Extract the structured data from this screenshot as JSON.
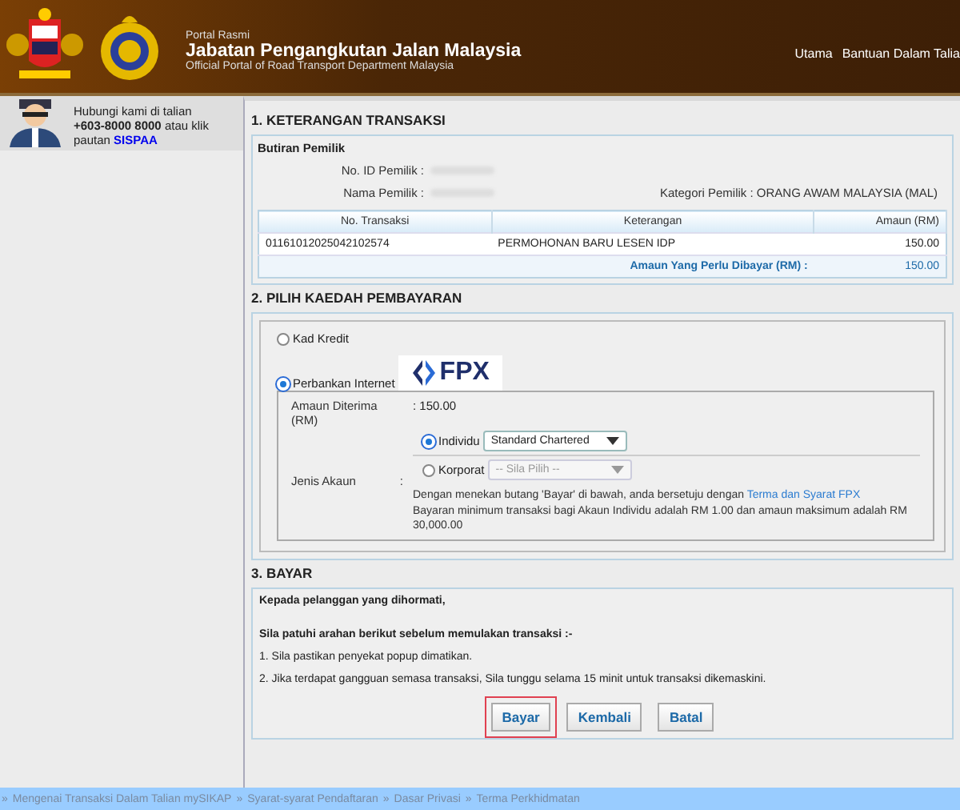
{
  "header": {
    "subtitle_top": "Portal Rasmi",
    "title": "Jabatan Pengangkutan Jalan Malaysia",
    "subtitle": "Official Portal of Road Transport Department Malaysia",
    "nav": [
      "Utama",
      "Bantuan Dalam Talia"
    ]
  },
  "sidebar": {
    "contact_line": "Hubungi kami di talian",
    "phone": "+603-8000 8000",
    "after_phone": "atau klik",
    "link_prefix": "pautan",
    "link": "SISPAA"
  },
  "section1": {
    "title": "1. KETERANGAN TRANSAKSI",
    "group": "Butiran Pemilik",
    "id_label": "No. ID Pemilik :",
    "name_label": "Nama Pemilik :",
    "category_label": "Kategori Pemilik :",
    "category": "ORANG AWAM MALAYSIA (MAL)",
    "columns": [
      "No. Transaksi",
      "Keterangan",
      "Amaun (RM)"
    ],
    "rows": [
      {
        "no": "01161012025042102574",
        "desc": "PERMOHONAN BARU LESEN IDP",
        "amount": "150.00"
      }
    ],
    "total_label": "Amaun Yang Perlu Dibayar (RM) :",
    "total": "150.00"
  },
  "section2": {
    "title": "2. PILIH KAEDAH PEMBAYARAN",
    "methods": [
      {
        "label": "Kad Kredit",
        "selected": false
      },
      {
        "label": "Perbankan Internet",
        "selected": true
      }
    ],
    "fpx_logo": "FPX",
    "received_label": "Amaun Diterima (RM)",
    "received": ": 150.00",
    "account_label": "Jenis Akaun",
    "account_colon": ":",
    "accounts": [
      {
        "label": "Individu",
        "selected": true,
        "bank": "Standard Chartered",
        "disabled": false
      },
      {
        "label": "Korporat",
        "selected": false,
        "bank": "-- Sila Pilih --",
        "disabled": true
      }
    ],
    "agree_text": "Dengan menekan butang 'Bayar' di bawah, anda bersetuju dengan",
    "agree_link": "Terma dan Syarat FPX",
    "limit_text": "Bayaran minimum transaksi bagi Akaun Individu adalah RM 1.00 dan amaun maksimum adalah RM 30,000.00"
  },
  "section3": {
    "title": "3. BAYAR",
    "greeting": "Kepada pelanggan yang dihormati,",
    "instruction": "Sila patuhi arahan berikut sebelum memulakan transaksi :-",
    "notes": [
      "1. Sila pastikan penyekat popup dimatikan.",
      "2. Jika terdapat gangguan semasa transaksi, Sila tunggu selama 15 minit untuk transaksi dikemaskini."
    ],
    "buttons": [
      {
        "label": "Bayar",
        "highlighted": true
      },
      {
        "label": "Kembali",
        "highlighted": false
      },
      {
        "label": "Batal",
        "highlighted": false
      }
    ]
  },
  "footer": {
    "separator": "»",
    "links": [
      "Mengenai Transaksi Dalam Talian mySIKAP",
      "Syarat-syarat Pendaftaran",
      "Dasar Privasi",
      "Terma Perkhidmatan"
    ]
  }
}
